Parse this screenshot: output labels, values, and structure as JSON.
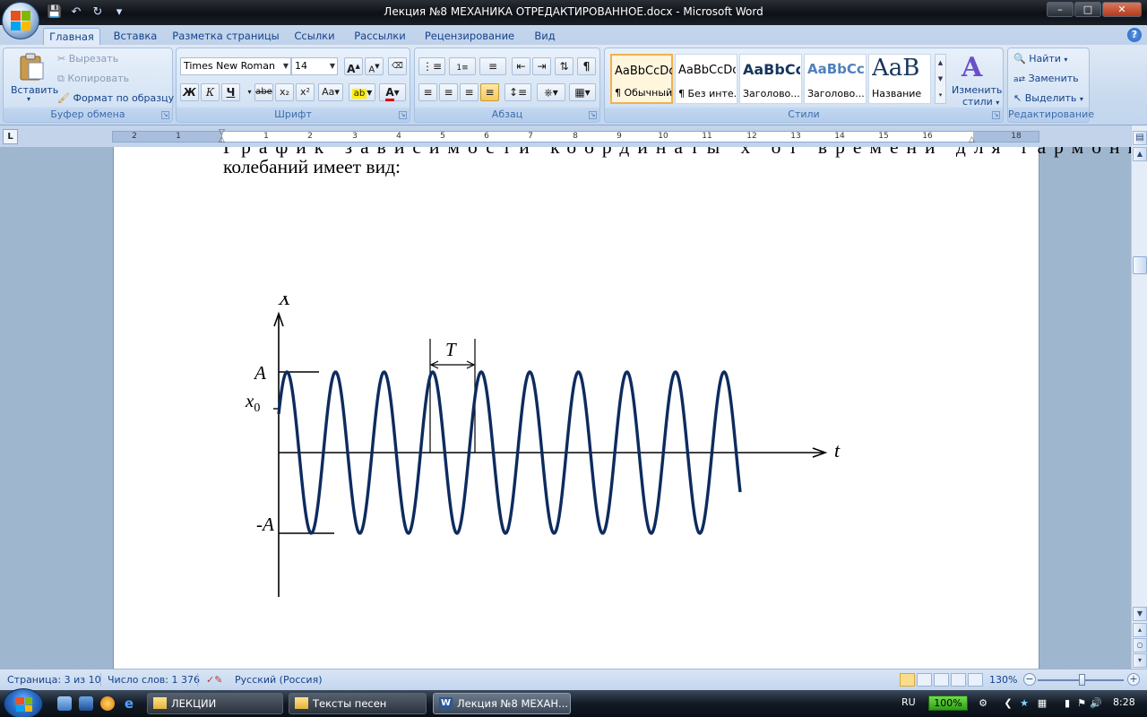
{
  "window": {
    "title": "Лекция №8 МЕХАНИКА ОТРЕДАКТИРОВАННОЕ.docx - Microsoft Word"
  },
  "tabs": [
    "Главная",
    "Вставка",
    "Разметка страницы",
    "Ссылки",
    "Рассылки",
    "Рецензирование",
    "Вид"
  ],
  "ribbon": {
    "clipboard": {
      "paste": "Вставить",
      "cut": "Вырезать",
      "copy": "Копировать",
      "format_painter": "Формат по образцу",
      "label": "Буфер обмена"
    },
    "font": {
      "name": "Times New Roman",
      "size": "14",
      "bold": "Ж",
      "italic": "К",
      "underline": "Ч",
      "strike": "abe",
      "subscript": "x₂",
      "superscript": "x²",
      "change_case": "Aa",
      "grow": "A",
      "shrink": "A",
      "font_color": "A",
      "label": "Шрифт"
    },
    "paragraph": {
      "label": "Абзац",
      "show_marks": "¶"
    },
    "styles": {
      "items": [
        {
          "sample": "AaBbCcDc",
          "name": "¶ Обычный"
        },
        {
          "sample": "AaBbCcDc",
          "name": "¶ Без инте..."
        },
        {
          "sample": "AaBbCc",
          "name": "Заголово..."
        },
        {
          "sample": "AaBbCc",
          "name": "Заголово..."
        },
        {
          "sample": "AaB",
          "name": "Название"
        }
      ],
      "change_styles_line1": "Изменить",
      "change_styles_line2": "стили",
      "label": "Стили"
    },
    "editing": {
      "find": "Найти",
      "replace": "Заменить",
      "select": "Выделить",
      "label": "Редактирование"
    }
  },
  "ruler": {
    "numbers": [
      "2",
      "1",
      "",
      "1",
      "2",
      "3",
      "4",
      "5",
      "6",
      "7",
      "8",
      "9",
      "10",
      "11",
      "12",
      "13",
      "14",
      "15",
      "16",
      "",
      "18"
    ]
  },
  "document": {
    "line_partial": "График зависимости координаты x от времени для гармонических",
    "line2": "колебаний имеет вид:",
    "figure": {
      "y_label": "X",
      "x_label": "t",
      "amp_label": "A",
      "x0_label": "x",
      "x0_sub": "0",
      "neg_amp_label": "-A",
      "period_label": "T"
    }
  },
  "status": {
    "page": "Страница: 3 из 10",
    "words": "Число слов: 1 376",
    "language": "Русский (Россия)",
    "zoom": "130%"
  },
  "taskbar": {
    "tasks": [
      "ЛЕКЦИИ",
      "Тексты песен",
      "Лекция №8 МЕХАН..."
    ],
    "lang": "RU",
    "battery": "100%",
    "time": "8:28"
  },
  "colors": {
    "wave": "#0d2b5e",
    "accent": "#15428b"
  }
}
